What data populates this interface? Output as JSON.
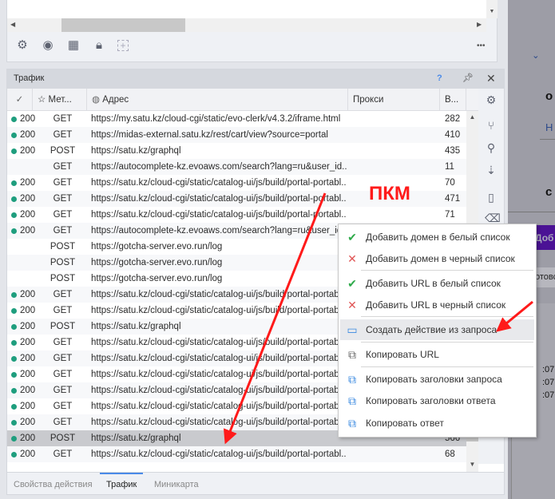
{
  "toolbar": {
    "more": "•••"
  },
  "traffic": {
    "title": "Трафик",
    "help": "?",
    "columns": {
      "status": "✓",
      "method": "Мет...",
      "address": "Адрес",
      "proxy": "Прокси",
      "time": "В..."
    },
    "rows": [
      {
        "status": "200",
        "method": "GET",
        "url": "https://my.satu.kz/cloud-cgi/static/evo-clerk/v4.3.2/iframe.html",
        "size": "282"
      },
      {
        "status": "200",
        "method": "GET",
        "url": "https://midas-external.satu.kz/rest/cart/view?source=portal",
        "size": "410"
      },
      {
        "status": "200",
        "method": "POST",
        "url": "https://satu.kz/graphql",
        "size": "435"
      },
      {
        "status": "",
        "method": "GET",
        "url": "https://autocomplete-kz.evoaws.com/search?lang=ru&user_id...",
        "size": "11"
      },
      {
        "status": "200",
        "method": "GET",
        "url": "https://satu.kz/cloud-cgi/static/catalog-ui/js/build/portal-portabl...",
        "size": "70"
      },
      {
        "status": "200",
        "method": "GET",
        "url": "https://satu.kz/cloud-cgi/static/catalog-ui/js/build/portal-portabl...",
        "size": "471"
      },
      {
        "status": "200",
        "method": "GET",
        "url": "https://satu.kz/cloud-cgi/static/catalog-ui/js/build/portal-portabl...",
        "size": "71"
      },
      {
        "status": "200",
        "method": "GET",
        "url": "https://autocomplete-kz.evoaws.com/search?lang=ru&user_id...",
        "size": ""
      },
      {
        "status": "",
        "method": "POST",
        "url": "https://gotcha-server.evo.run/log",
        "size": ""
      },
      {
        "status": "",
        "method": "POST",
        "url": "https://gotcha-server.evo.run/log",
        "size": ""
      },
      {
        "status": "",
        "method": "POST",
        "url": "https://gotcha-server.evo.run/log",
        "size": ""
      },
      {
        "status": "200",
        "method": "GET",
        "url": "https://satu.kz/cloud-cgi/static/catalog-ui/js/build/portal-portabl",
        "size": ""
      },
      {
        "status": "200",
        "method": "GET",
        "url": "https://satu.kz/cloud-cgi/static/catalog-ui/js/build/portal-portabl",
        "size": ""
      },
      {
        "status": "200",
        "method": "POST",
        "url": "https://satu.kz/graphql",
        "size": ""
      },
      {
        "status": "200",
        "method": "GET",
        "url": "https://satu.kz/cloud-cgi/static/catalog-ui/js/build/portal-portabl",
        "size": ""
      },
      {
        "status": "200",
        "method": "GET",
        "url": "https://satu.kz/cloud-cgi/static/catalog-ui/js/build/portal-portabl",
        "size": ""
      },
      {
        "status": "200",
        "method": "GET",
        "url": "https://satu.kz/cloud-cgi/static/catalog-ui/js/build/portal-portabl",
        "size": ""
      },
      {
        "status": "200",
        "method": "GET",
        "url": "https://satu.kz/cloud-cgi/static/catalog-ui/js/build/portal-portabl",
        "size": ""
      },
      {
        "status": "200",
        "method": "GET",
        "url": "https://satu.kz/cloud-cgi/static/catalog-ui/js/build/portal-portabl",
        "size": ""
      },
      {
        "status": "200",
        "method": "GET",
        "url": "https://satu.kz/cloud-cgi/static/catalog-ui/js/build/portal-portabl",
        "size": ""
      },
      {
        "status": "200",
        "method": "POST",
        "url": "https://satu.kz/graphql",
        "size": "566",
        "selected": true
      },
      {
        "status": "200",
        "method": "GET",
        "url": "https://satu.kz/cloud-cgi/static/catalog-ui/js/build/portal-portabl...",
        "size": "68"
      }
    ]
  },
  "tabs": [
    "Свойства действия",
    "Трафик",
    "Миникарта"
  ],
  "context_menu": [
    {
      "label": "Добавить домен в белый список",
      "icon": "check-icon"
    },
    {
      "label": "Добавить домен в черный список",
      "icon": "cross-icon"
    },
    {
      "label": "Добавить URL в белый список",
      "icon": "check-icon"
    },
    {
      "label": "Добавить URL в черный список",
      "icon": "cross-icon"
    },
    {
      "label": "Создать действие из запроса",
      "icon": "create-action-icon",
      "highlighted": true
    },
    {
      "label": "Копировать URL",
      "icon": "copy-icon"
    },
    {
      "label": "Копировать заголовки запроса",
      "icon": "copy-icon"
    },
    {
      "label": "Копировать заголовки ответа",
      "icon": "copy-icon"
    },
    {
      "label": "Копировать ответ",
      "icon": "copy-icon"
    }
  ],
  "annotation": {
    "label": "ПКМ",
    "color": "#ff1a1a"
  },
  "background": {
    "t1": "о",
    "t2": "Н",
    "t3": "с",
    "button": "Доб",
    "t4": "отовс",
    "time1": ":07:",
    "time2": ":07:",
    "time3": ":07:"
  }
}
